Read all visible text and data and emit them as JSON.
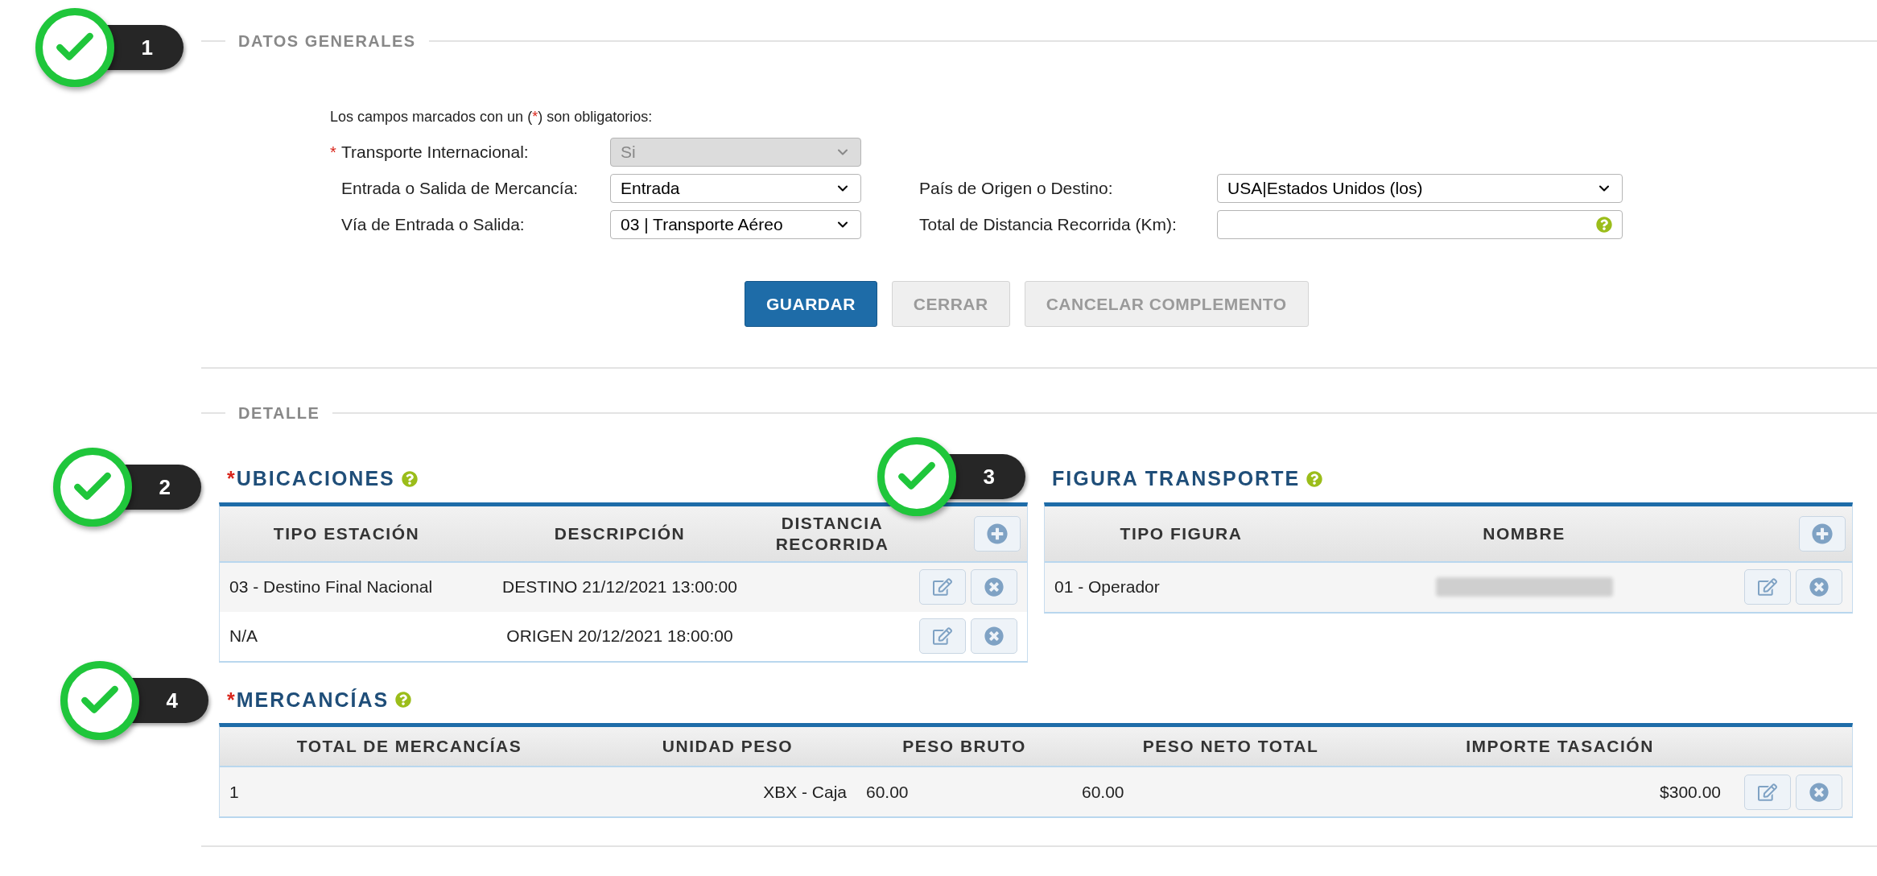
{
  "annotations": [
    {
      "number": "1"
    },
    {
      "number": "2"
    },
    {
      "number": "3"
    },
    {
      "number": "4"
    }
  ],
  "datos_generales": {
    "title": "DATOS GENERALES",
    "required_note": [
      "Los campos marcados con un (",
      "*",
      ") son obligatorios:"
    ],
    "left_fields": [
      {
        "label": "Transporte Internacional:",
        "value": "Si",
        "required": true,
        "disabled": true,
        "kind": "select"
      },
      {
        "label": "Entrada o Salida de Mercancía:",
        "value": "Entrada",
        "required": false,
        "disabled": false,
        "kind": "select"
      },
      {
        "label": "Vía de Entrada o Salida:",
        "value": "03 | Transporte Aéreo",
        "required": false,
        "disabled": false,
        "kind": "select"
      }
    ],
    "right_fields": [
      {
        "label": "País de Origen o Destino:",
        "value": "USA|Estados Unidos (los)",
        "required": false,
        "disabled": false,
        "kind": "select"
      },
      {
        "label": "Total de Distancia Recorrida (Km):",
        "required": false,
        "disabled": false,
        "kind": "text"
      }
    ],
    "buttons": [
      {
        "label": "GUARDAR",
        "primary": true
      },
      {
        "label": "CERRAR",
        "primary": false
      },
      {
        "label": "CANCELAR COMPLEMENTO",
        "primary": false
      }
    ]
  },
  "detalle": {
    "title": "DETALLE",
    "ubicaciones": {
      "title": "UBICACIONES",
      "required": true,
      "columns": [
        "TIPO ESTACIÓN",
        "DESCRIPCIÓN",
        "DISTANCIA RECORRIDA"
      ],
      "rows": [
        {
          "cells": [
            "03 - Destino Final Nacional",
            "DESTINO 21/12/2021 13:00:00"
          ]
        },
        {
          "cells": [
            "N/A",
            "ORIGEN 20/12/2021 18:00:00"
          ]
        }
      ]
    },
    "figura_transporte": {
      "title": "FIGURA TRANSPORTE",
      "required": false,
      "columns": [
        "TIPO FIGURA",
        "NOMBRE"
      ],
      "rows": [
        {
          "cells": [
            "01 - Operador"
          ],
          "name_redacted": true
        }
      ]
    },
    "mercancias": {
      "title": "MERCANCÍAS",
      "required": true,
      "columns": [
        "TOTAL DE MERCANCÍAS",
        "UNIDAD PESO",
        "PESO BRUTO",
        "PESO NETO TOTAL",
        "IMPORTE TASACIÓN"
      ],
      "rows": [
        {
          "cells": [
            "1",
            "XBX - Caja",
            "60.00",
            "60.00",
            "$300.00"
          ]
        }
      ]
    }
  }
}
